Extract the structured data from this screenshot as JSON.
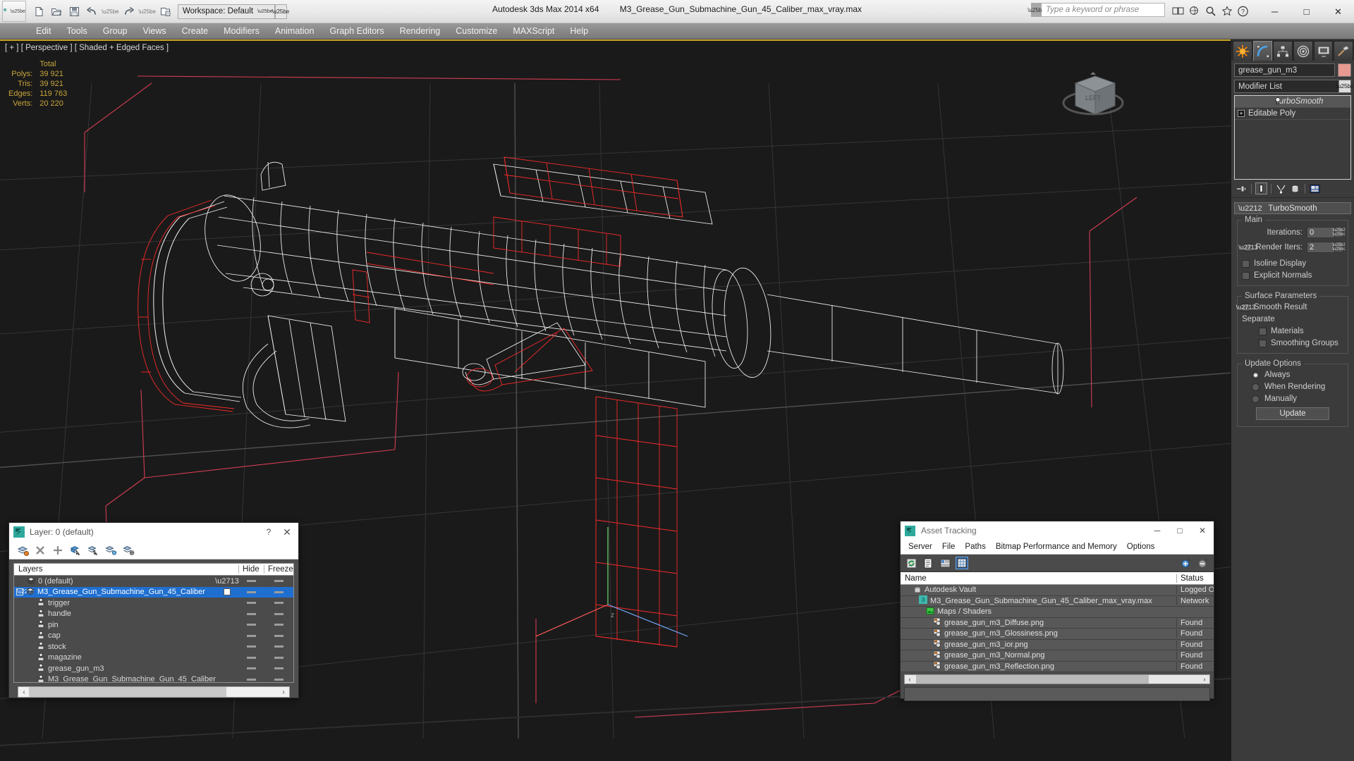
{
  "titlebar": {
    "app_title": "Autodesk 3ds Max  2014 x64",
    "file_name": "M3_Grease_Gun_Submachine_Gun_45_Caliber_max_vray.max",
    "workspace_label": "Workspace: Default",
    "search_placeholder": "Type a keyword or phrase",
    "quick_access": [
      {
        "name": "new-file-icon",
        "glyph": "□"
      },
      {
        "name": "open-file-icon",
        "glyph": "▷"
      },
      {
        "name": "save-file-icon",
        "glyph": "▤"
      },
      {
        "name": "undo-icon",
        "glyph": "↶"
      },
      {
        "name": "redo-icon",
        "glyph": "↷"
      },
      {
        "name": "set-project-folder-icon",
        "glyph": "▣"
      }
    ],
    "window_controls": {
      "minimize": "─",
      "maximize": "□",
      "close": "✕"
    }
  },
  "menubar": {
    "items": [
      "Edit",
      "Tools",
      "Group",
      "Views",
      "Create",
      "Modifiers",
      "Animation",
      "Graph Editors",
      "Rendering",
      "Customize",
      "MAXScript",
      "Help"
    ]
  },
  "viewport": {
    "label": "[ + ] [ Perspective ] [ Shaded + Edged Faces ]",
    "viewcube_face": "LEFT",
    "stats": {
      "column_header": "Total",
      "rows": [
        {
          "key": "Polys:",
          "value": "39 921"
        },
        {
          "key": "Tris:",
          "value": "39 921"
        },
        {
          "key": "Edges:",
          "value": "119 763"
        },
        {
          "key": "Verts:",
          "value": "20 220"
        }
      ]
    },
    "colors": {
      "background": "#1a1a1a",
      "wireframe_white": "#ffffff",
      "wireframe_selected": "#ff2222",
      "grid": "#3c3c3c",
      "stats_text": "#c8a63a"
    }
  },
  "command_panel": {
    "tabs": [
      {
        "name": "create-tab",
        "icon": "star-icon"
      },
      {
        "name": "modify-tab",
        "icon": "arc-icon",
        "active": true
      },
      {
        "name": "hierarchy-tab",
        "icon": "hierarchy-icon"
      },
      {
        "name": "motion-tab",
        "icon": "wheel-icon"
      },
      {
        "name": "display-tab",
        "icon": "monitor-icon"
      },
      {
        "name": "utilities-tab",
        "icon": "hammer-icon"
      }
    ],
    "object_name": "grease_gun_m3",
    "object_color": "#e79a92",
    "modifier_list_label": "Modifier List",
    "stack": [
      {
        "label": "TurboSmooth",
        "selected": true,
        "icon": "lightbulb-icon"
      },
      {
        "label": "Editable Poly",
        "selected": false,
        "icon": "plus-box-icon"
      }
    ],
    "stack_tools": [
      {
        "name": "pin-stack-icon",
        "glyph": "⊸"
      },
      {
        "name": "show-end-result-icon",
        "glyph": "█",
        "framed": true
      },
      {
        "name": "make-unique-icon",
        "glyph": "⅄"
      },
      {
        "name": "remove-modifier-icon",
        "glyph": "⛃"
      },
      {
        "name": "configure-modifier-sets-icon",
        "glyph": "▦"
      }
    ],
    "rollout": {
      "title": "TurboSmooth",
      "groups": [
        {
          "title": "Main",
          "fields": [
            {
              "type": "spinner",
              "label": "Iterations:",
              "value": "0",
              "checkbox": false
            },
            {
              "type": "spinner",
              "label": "Render Iters:",
              "value": "2",
              "checkbox": true,
              "checked": true
            },
            {
              "type": "checkbox",
              "label": "Isoline Display",
              "checked": false
            },
            {
              "type": "checkbox",
              "label": "Explicit Normals",
              "checked": false
            }
          ]
        },
        {
          "title": "Surface Parameters",
          "fields": [
            {
              "type": "checkbox",
              "label": "Smooth Result",
              "checked": true
            },
            {
              "type": "text",
              "label": "Separate"
            },
            {
              "type": "checkbox",
              "label": "Materials",
              "checked": false,
              "indent": true
            },
            {
              "type": "checkbox",
              "label": "Smoothing Groups",
              "checked": false,
              "indent": true
            }
          ]
        },
        {
          "title": "Update Options",
          "fields": [
            {
              "type": "radio",
              "label": "Always",
              "checked": true
            },
            {
              "type": "radio",
              "label": "When Rendering",
              "checked": false
            },
            {
              "type": "radio",
              "label": "Manually",
              "checked": false
            },
            {
              "type": "button",
              "label": "Update"
            }
          ]
        }
      ]
    }
  },
  "layer_dialog": {
    "title": "Layer: 0 (default)",
    "help_glyph": "?",
    "close_glyph": "✕",
    "tools": [
      {
        "name": "create-new-layer-icon"
      },
      {
        "name": "delete-highlighted-layers-icon"
      },
      {
        "name": "add-selected-objects-icon"
      },
      {
        "name": "select-highlighted-objects-icon"
      },
      {
        "name": "select-object-layer-icon"
      },
      {
        "name": "highlight-selected-objects-layer-icon"
      },
      {
        "name": "hide-unhide-layer-icon"
      }
    ],
    "columns": {
      "name": "Layers",
      "hide": "Hide",
      "freeze": "Freeze"
    },
    "rows": [
      {
        "label": "0 (default)",
        "indent": 1,
        "icon": "layer-icon",
        "selected": false,
        "check": "tick"
      },
      {
        "label": "M3_Grease_Gun_Submachine_Gun_45_Caliber",
        "indent": 0,
        "icon": "layer-icon",
        "selected": true,
        "check": "box",
        "expander": "−"
      },
      {
        "label": "trigger",
        "indent": 2,
        "icon": "object-icon",
        "selected": false,
        "check": ""
      },
      {
        "label": "handle",
        "indent": 2,
        "icon": "object-icon",
        "selected": false,
        "check": ""
      },
      {
        "label": "pin",
        "indent": 2,
        "icon": "object-icon",
        "selected": false,
        "check": ""
      },
      {
        "label": "cap",
        "indent": 2,
        "icon": "object-icon",
        "selected": false,
        "check": ""
      },
      {
        "label": "stock",
        "indent": 2,
        "icon": "object-icon",
        "selected": false,
        "check": ""
      },
      {
        "label": "magazine",
        "indent": 2,
        "icon": "object-icon",
        "selected": false,
        "check": ""
      },
      {
        "label": "grease_gun_m3",
        "indent": 2,
        "icon": "object-icon",
        "selected": false,
        "check": ""
      },
      {
        "label": "M3_Grease_Gun_Submachine_Gun_45_Caliber",
        "indent": 2,
        "icon": "object-icon",
        "selected": false,
        "check": ""
      }
    ],
    "scroll_left": "‹",
    "scroll_right": "›"
  },
  "asset_tracking": {
    "title": "Asset Tracking",
    "window_controls": {
      "minimize": "─",
      "maximize": "□",
      "close": "✕"
    },
    "menu": [
      "Server",
      "File",
      "Paths",
      "Bitmap Performance and Memory",
      "Options"
    ],
    "tools": [
      {
        "name": "refresh-icon",
        "selected": false
      },
      {
        "name": "list-view-icon",
        "selected": false
      },
      {
        "name": "detail-view-icon",
        "selected": false
      },
      {
        "name": "grid-view-icon",
        "selected": true
      }
    ],
    "right_tools": [
      {
        "name": "check-in-icon"
      },
      {
        "name": "check-out-icon"
      }
    ],
    "columns": {
      "name": "Name",
      "status": "Status"
    },
    "rows": [
      {
        "name": "Autodesk Vault",
        "status": "Logged O",
        "indent": 1,
        "icon": "vault-icon"
      },
      {
        "name": "M3_Grease_Gun_Submachine_Gun_45_Caliber_max_vray.max",
        "status": "Network",
        "indent": 2,
        "icon": "max-file-icon"
      },
      {
        "name": "Maps / Shaders",
        "status": "",
        "indent": 3,
        "icon": "maps-icon"
      },
      {
        "name": "grease_gun_m3_Diffuse.png",
        "status": "Found",
        "indent": 4,
        "icon": "bitmap-icon"
      },
      {
        "name": "grease_gun_m3_Glossiness.png",
        "status": "Found",
        "indent": 4,
        "icon": "bitmap-icon"
      },
      {
        "name": "grease_gun_m3_ior.png",
        "status": "Found",
        "indent": 4,
        "icon": "bitmap-icon"
      },
      {
        "name": "grease_gun_m3_Normal.png",
        "status": "Found",
        "indent": 4,
        "icon": "bitmap-icon"
      },
      {
        "name": "grease_gun_m3_Reflection.png",
        "status": "Found",
        "indent": 4,
        "icon": "bitmap-icon"
      }
    ],
    "scroll_left": "‹",
    "scroll_right": "›"
  }
}
